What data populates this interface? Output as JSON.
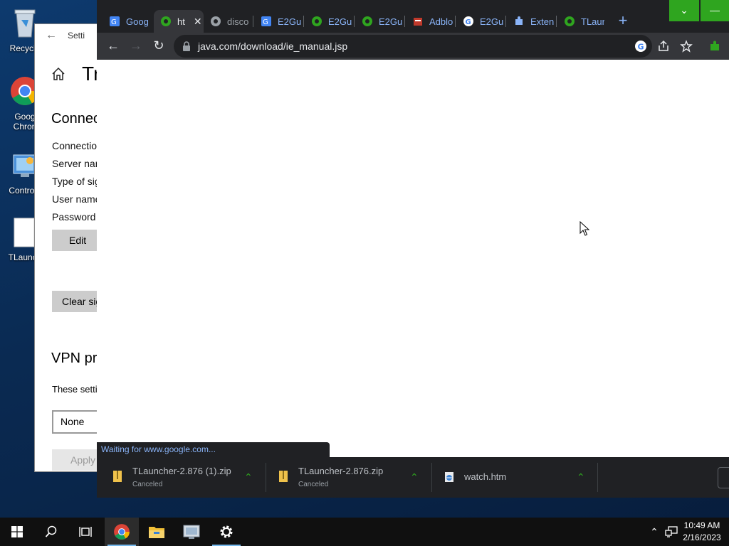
{
  "desktop": {
    "icons": [
      {
        "label": "Recycle"
      },
      {
        "label": "Goog Chron"
      },
      {
        "label": "Control I"
      },
      {
        "label": "TLaunch"
      }
    ]
  },
  "settings": {
    "title": "Setti",
    "page_title": "Tr",
    "section_heading": "Connec",
    "fields": [
      "Connection",
      "Server nan",
      "Type of sig",
      "User name",
      "Password ("
    ],
    "edit_label": "Edit",
    "clear_label": "Clear sig",
    "vpn_heading": "VPN pr",
    "vpn_text": "These setti",
    "proxy_value": "None",
    "apply_label": "Apply"
  },
  "chrome": {
    "tabs": [
      {
        "label": "Goog"
      },
      {
        "label": "ht"
      },
      {
        "label": "disco"
      },
      {
        "label": "E2Gu"
      },
      {
        "label": "E2Gu"
      },
      {
        "label": "E2Gu"
      },
      {
        "label": "Adblo"
      },
      {
        "label": "E2Gu"
      },
      {
        "label": "Exten"
      },
      {
        "label": "TLaur"
      }
    ],
    "address": "java.com/download/ie_manual.jsp",
    "status_text": "Waiting for www.google.com...",
    "downloads": [
      {
        "name": "TLauncher-2.876 (1).zip",
        "status": "Canceled"
      },
      {
        "name": "TLauncher-2.876.zip",
        "status": "Canceled"
      },
      {
        "name": "watch.htm",
        "status": ""
      }
    ],
    "colors": {
      "frame": "#202124",
      "toolbar": "#35363a",
      "accent": "#2fa51f",
      "link": "#8ab4f8"
    }
  },
  "taskbar": {
    "time": "10:49 AM",
    "date": "2/16/2023"
  }
}
